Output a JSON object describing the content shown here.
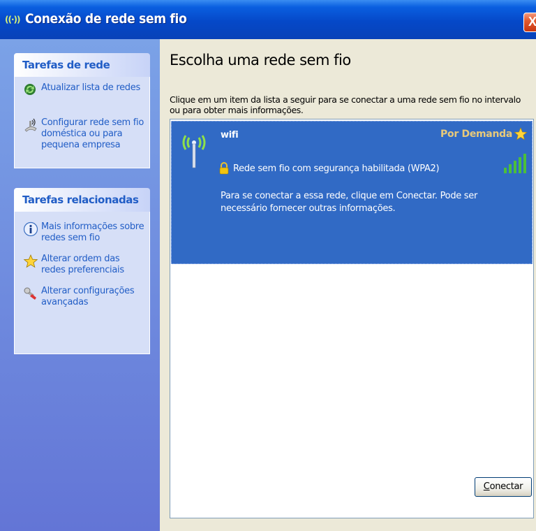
{
  "window": {
    "title": "Conexão de rede sem fio",
    "close_label": "X",
    "app_icon_glyph": "((·))"
  },
  "sidebar": {
    "network_tasks": {
      "header": "Tarefas de rede",
      "items": [
        {
          "label": "Atualizar lista de redes",
          "icon": "refresh-icon"
        },
        {
          "label": "Configurar rede sem fio doméstica ou para pequena empresa",
          "icon": "wireless-setup-icon"
        }
      ]
    },
    "related_tasks": {
      "header": "Tarefas relacionadas",
      "items": [
        {
          "label": "Mais informações sobre redes sem fio",
          "icon": "info-icon"
        },
        {
          "label": "Alterar ordem das redes preferenciais",
          "icon": "star-icon"
        },
        {
          "label": "Alterar configurações avançadas",
          "icon": "settings-tool-icon"
        }
      ]
    }
  },
  "main": {
    "heading": "Escolha uma rede sem fio",
    "description": "Clique em um item da lista a seguir para se conectar a uma rede sem fio no intervalo ou para obter mais informações.",
    "networks": [
      {
        "name": "wifi",
        "mode": "Por Demanda",
        "security": "Rede sem fio com segurança habilitada (WPA2)",
        "message": "Para se conectar a essa rede, clique em Conectar. Pode ser necessário fornecer outras informações.",
        "signal_bars": 5,
        "selected": true
      }
    ],
    "connect_button": {
      "accel": "C",
      "rest": "onectar"
    }
  },
  "colors": {
    "titlebar": "#0548c8",
    "sidebar": "#6f8fdf",
    "selection": "#316ac5",
    "task_link": "#215dc6",
    "signal": "#4cbf3a"
  }
}
